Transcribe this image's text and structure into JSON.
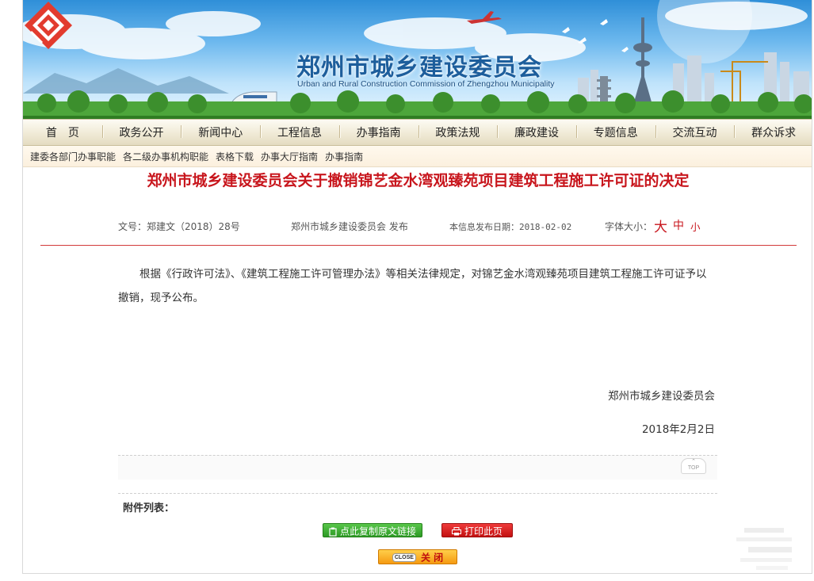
{
  "header": {
    "title_cn": "郑州市城乡建设委员会",
    "title_en": "Urban and Rural Construction Commission of Zhengzhou Municipality"
  },
  "nav": {
    "items": [
      "首　页",
      "政务公开",
      "新闻中心",
      "工程信息",
      "办事指南",
      "政策法规",
      "廉政建设",
      "专题信息",
      "交流互动",
      "群众诉求"
    ]
  },
  "subnav": {
    "items": [
      "建委各部门办事职能",
      "各二级办事机构职能",
      "表格下载",
      "办事大厅指南",
      "办事指南"
    ]
  },
  "article": {
    "title": "郑州市城乡建设委员会关于撤销锦艺金水湾观臻苑项目建筑工程施工许可证的决定",
    "doc_no": "文号：郑建文（2018）28号",
    "publisher": "郑州市城乡建设委员会 发布",
    "publish_date": "本信息发布日期：2018-02-02",
    "font_size_label": "字体大小：",
    "font_large": "大",
    "font_medium": "中",
    "font_small": "小",
    "body": "根据《行政许可法》、《建筑工程施工许可管理办法》等相关法律规定，对锦艺金水湾观臻苑项目建筑工程施工许可证予以撤销，现予公布。",
    "signature": "郑州市城乡建设委员会",
    "signature_date": "2018年2月2日"
  },
  "footer": {
    "top_label": "TOP",
    "attachments_label": "附件列表：",
    "copy_link_button": "点此复制原文链接",
    "print_button": "打印此页",
    "close_tag": "CLOSE",
    "close_button": "关 闭"
  },
  "colors": {
    "title_red": "#c8161d",
    "brand_blue": "#1d5e9c",
    "nav_bg": "#f0ead6",
    "copy_green": "#2d9a25",
    "print_red": "#c31111",
    "close_orange": "#f59a12"
  },
  "icons": {
    "logo": "commission-logo",
    "copy": "clipboard-icon",
    "print": "print-icon",
    "top": "arrow-up-icon"
  }
}
